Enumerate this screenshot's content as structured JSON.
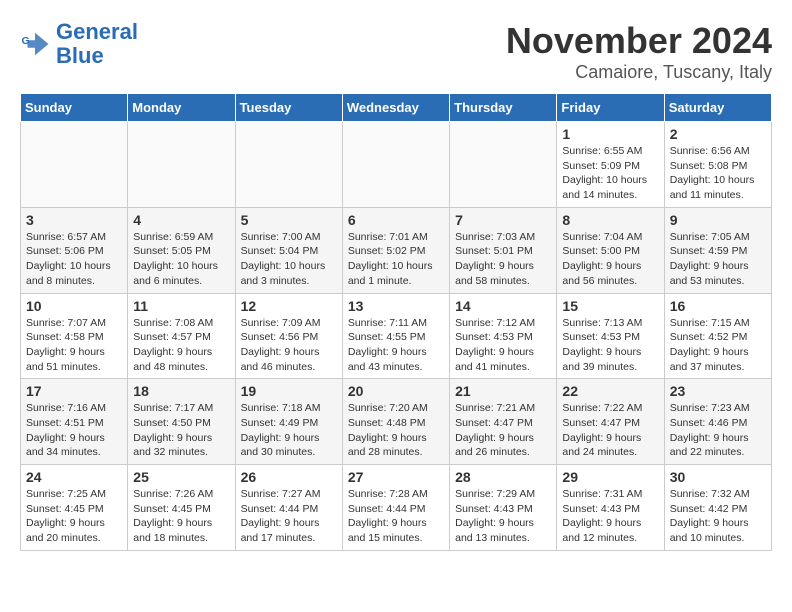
{
  "header": {
    "logo_line1": "General",
    "logo_line2": "Blue",
    "month": "November 2024",
    "location": "Camaiore, Tuscany, Italy"
  },
  "days_of_week": [
    "Sunday",
    "Monday",
    "Tuesday",
    "Wednesday",
    "Thursday",
    "Friday",
    "Saturday"
  ],
  "weeks": [
    [
      {
        "day": "",
        "info": ""
      },
      {
        "day": "",
        "info": ""
      },
      {
        "day": "",
        "info": ""
      },
      {
        "day": "",
        "info": ""
      },
      {
        "day": "",
        "info": ""
      },
      {
        "day": "1",
        "info": "Sunrise: 6:55 AM\nSunset: 5:09 PM\nDaylight: 10 hours and 14 minutes."
      },
      {
        "day": "2",
        "info": "Sunrise: 6:56 AM\nSunset: 5:08 PM\nDaylight: 10 hours and 11 minutes."
      }
    ],
    [
      {
        "day": "3",
        "info": "Sunrise: 6:57 AM\nSunset: 5:06 PM\nDaylight: 10 hours and 8 minutes."
      },
      {
        "day": "4",
        "info": "Sunrise: 6:59 AM\nSunset: 5:05 PM\nDaylight: 10 hours and 6 minutes."
      },
      {
        "day": "5",
        "info": "Sunrise: 7:00 AM\nSunset: 5:04 PM\nDaylight: 10 hours and 3 minutes."
      },
      {
        "day": "6",
        "info": "Sunrise: 7:01 AM\nSunset: 5:02 PM\nDaylight: 10 hours and 1 minute."
      },
      {
        "day": "7",
        "info": "Sunrise: 7:03 AM\nSunset: 5:01 PM\nDaylight: 9 hours and 58 minutes."
      },
      {
        "day": "8",
        "info": "Sunrise: 7:04 AM\nSunset: 5:00 PM\nDaylight: 9 hours and 56 minutes."
      },
      {
        "day": "9",
        "info": "Sunrise: 7:05 AM\nSunset: 4:59 PM\nDaylight: 9 hours and 53 minutes."
      }
    ],
    [
      {
        "day": "10",
        "info": "Sunrise: 7:07 AM\nSunset: 4:58 PM\nDaylight: 9 hours and 51 minutes."
      },
      {
        "day": "11",
        "info": "Sunrise: 7:08 AM\nSunset: 4:57 PM\nDaylight: 9 hours and 48 minutes."
      },
      {
        "day": "12",
        "info": "Sunrise: 7:09 AM\nSunset: 4:56 PM\nDaylight: 9 hours and 46 minutes."
      },
      {
        "day": "13",
        "info": "Sunrise: 7:11 AM\nSunset: 4:55 PM\nDaylight: 9 hours and 43 minutes."
      },
      {
        "day": "14",
        "info": "Sunrise: 7:12 AM\nSunset: 4:53 PM\nDaylight: 9 hours and 41 minutes."
      },
      {
        "day": "15",
        "info": "Sunrise: 7:13 AM\nSunset: 4:53 PM\nDaylight: 9 hours and 39 minutes."
      },
      {
        "day": "16",
        "info": "Sunrise: 7:15 AM\nSunset: 4:52 PM\nDaylight: 9 hours and 37 minutes."
      }
    ],
    [
      {
        "day": "17",
        "info": "Sunrise: 7:16 AM\nSunset: 4:51 PM\nDaylight: 9 hours and 34 minutes."
      },
      {
        "day": "18",
        "info": "Sunrise: 7:17 AM\nSunset: 4:50 PM\nDaylight: 9 hours and 32 minutes."
      },
      {
        "day": "19",
        "info": "Sunrise: 7:18 AM\nSunset: 4:49 PM\nDaylight: 9 hours and 30 minutes."
      },
      {
        "day": "20",
        "info": "Sunrise: 7:20 AM\nSunset: 4:48 PM\nDaylight: 9 hours and 28 minutes."
      },
      {
        "day": "21",
        "info": "Sunrise: 7:21 AM\nSunset: 4:47 PM\nDaylight: 9 hours and 26 minutes."
      },
      {
        "day": "22",
        "info": "Sunrise: 7:22 AM\nSunset: 4:47 PM\nDaylight: 9 hours and 24 minutes."
      },
      {
        "day": "23",
        "info": "Sunrise: 7:23 AM\nSunset: 4:46 PM\nDaylight: 9 hours and 22 minutes."
      }
    ],
    [
      {
        "day": "24",
        "info": "Sunrise: 7:25 AM\nSunset: 4:45 PM\nDaylight: 9 hours and 20 minutes."
      },
      {
        "day": "25",
        "info": "Sunrise: 7:26 AM\nSunset: 4:45 PM\nDaylight: 9 hours and 18 minutes."
      },
      {
        "day": "26",
        "info": "Sunrise: 7:27 AM\nSunset: 4:44 PM\nDaylight: 9 hours and 17 minutes."
      },
      {
        "day": "27",
        "info": "Sunrise: 7:28 AM\nSunset: 4:44 PM\nDaylight: 9 hours and 15 minutes."
      },
      {
        "day": "28",
        "info": "Sunrise: 7:29 AM\nSunset: 4:43 PM\nDaylight: 9 hours and 13 minutes."
      },
      {
        "day": "29",
        "info": "Sunrise: 7:31 AM\nSunset: 4:43 PM\nDaylight: 9 hours and 12 minutes."
      },
      {
        "day": "30",
        "info": "Sunrise: 7:32 AM\nSunset: 4:42 PM\nDaylight: 9 hours and 10 minutes."
      }
    ]
  ]
}
